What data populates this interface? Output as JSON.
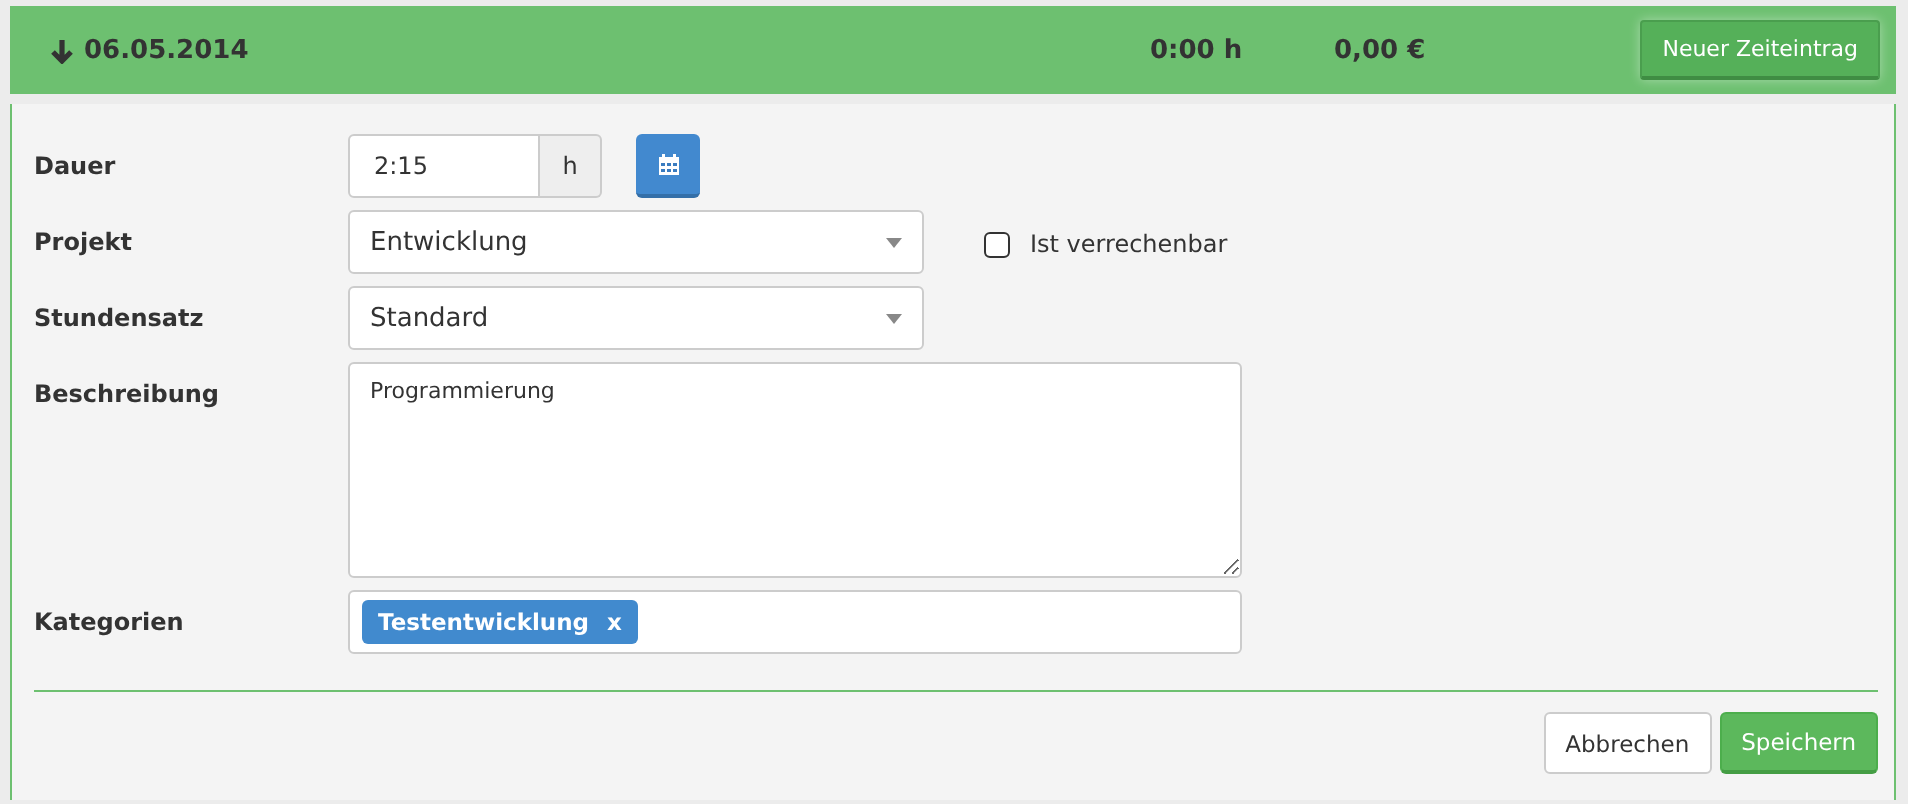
{
  "header": {
    "date": "06.05.2014",
    "hours": "0:00 h",
    "amount": "0,00 €",
    "new_button": "Neuer Zeiteintrag"
  },
  "form": {
    "duration": {
      "label": "Dauer",
      "value": "2:15",
      "unit": "h"
    },
    "project": {
      "label": "Projekt",
      "value": "Entwicklung",
      "billable": {
        "label": "Ist verrechenbar",
        "checked": false
      }
    },
    "rate": {
      "label": "Stundensatz",
      "value": "Standard"
    },
    "description": {
      "label": "Beschreibung",
      "value": "Programmierung"
    },
    "categories": {
      "label": "Kategorien",
      "tags": [
        {
          "label": "Testentwicklung",
          "remove": "x"
        }
      ]
    }
  },
  "buttons": {
    "cancel": "Abbrechen",
    "save": "Speichern"
  }
}
